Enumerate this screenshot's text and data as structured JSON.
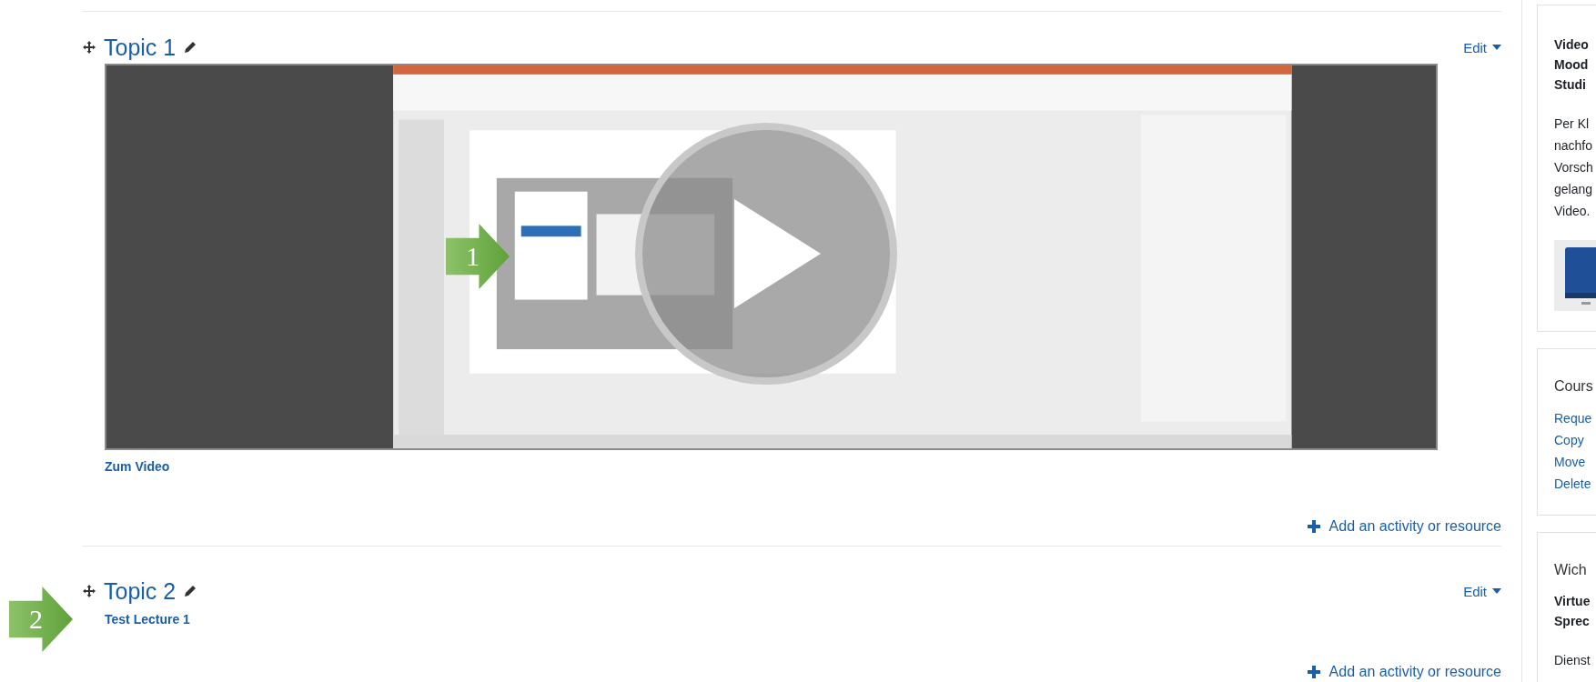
{
  "sections": [
    {
      "title": "Topic 1",
      "edit": "Edit",
      "activities": [
        {
          "kind": "video",
          "link": "Zum Video"
        }
      ],
      "add": "Add an activity or resource"
    },
    {
      "title": "Topic 2",
      "edit": "Edit",
      "activities": [
        {
          "kind": "link",
          "link": "Test Lecture 1"
        }
      ],
      "add": "Add an activity or resource"
    }
  ],
  "callouts": [
    {
      "label": "1"
    },
    {
      "label": "2"
    }
  ],
  "sidebar": {
    "blocks": [
      {
        "bold_lines": [
          "Video",
          "Mood",
          "Studi"
        ],
        "body_lines": [
          "Per Kl",
          "nachfo",
          "Vorsch",
          "gelang",
          "Video."
        ],
        "image": {
          "kind": "picture"
        }
      },
      {
        "title": "Cours",
        "links": [
          "Reque",
          "Copy",
          "Move",
          "Delete"
        ]
      },
      {
        "title": "Wich",
        "bold_lines": [
          "Virtue",
          "Sprec"
        ],
        "body_lines": [
          "Dienst"
        ]
      }
    ]
  }
}
